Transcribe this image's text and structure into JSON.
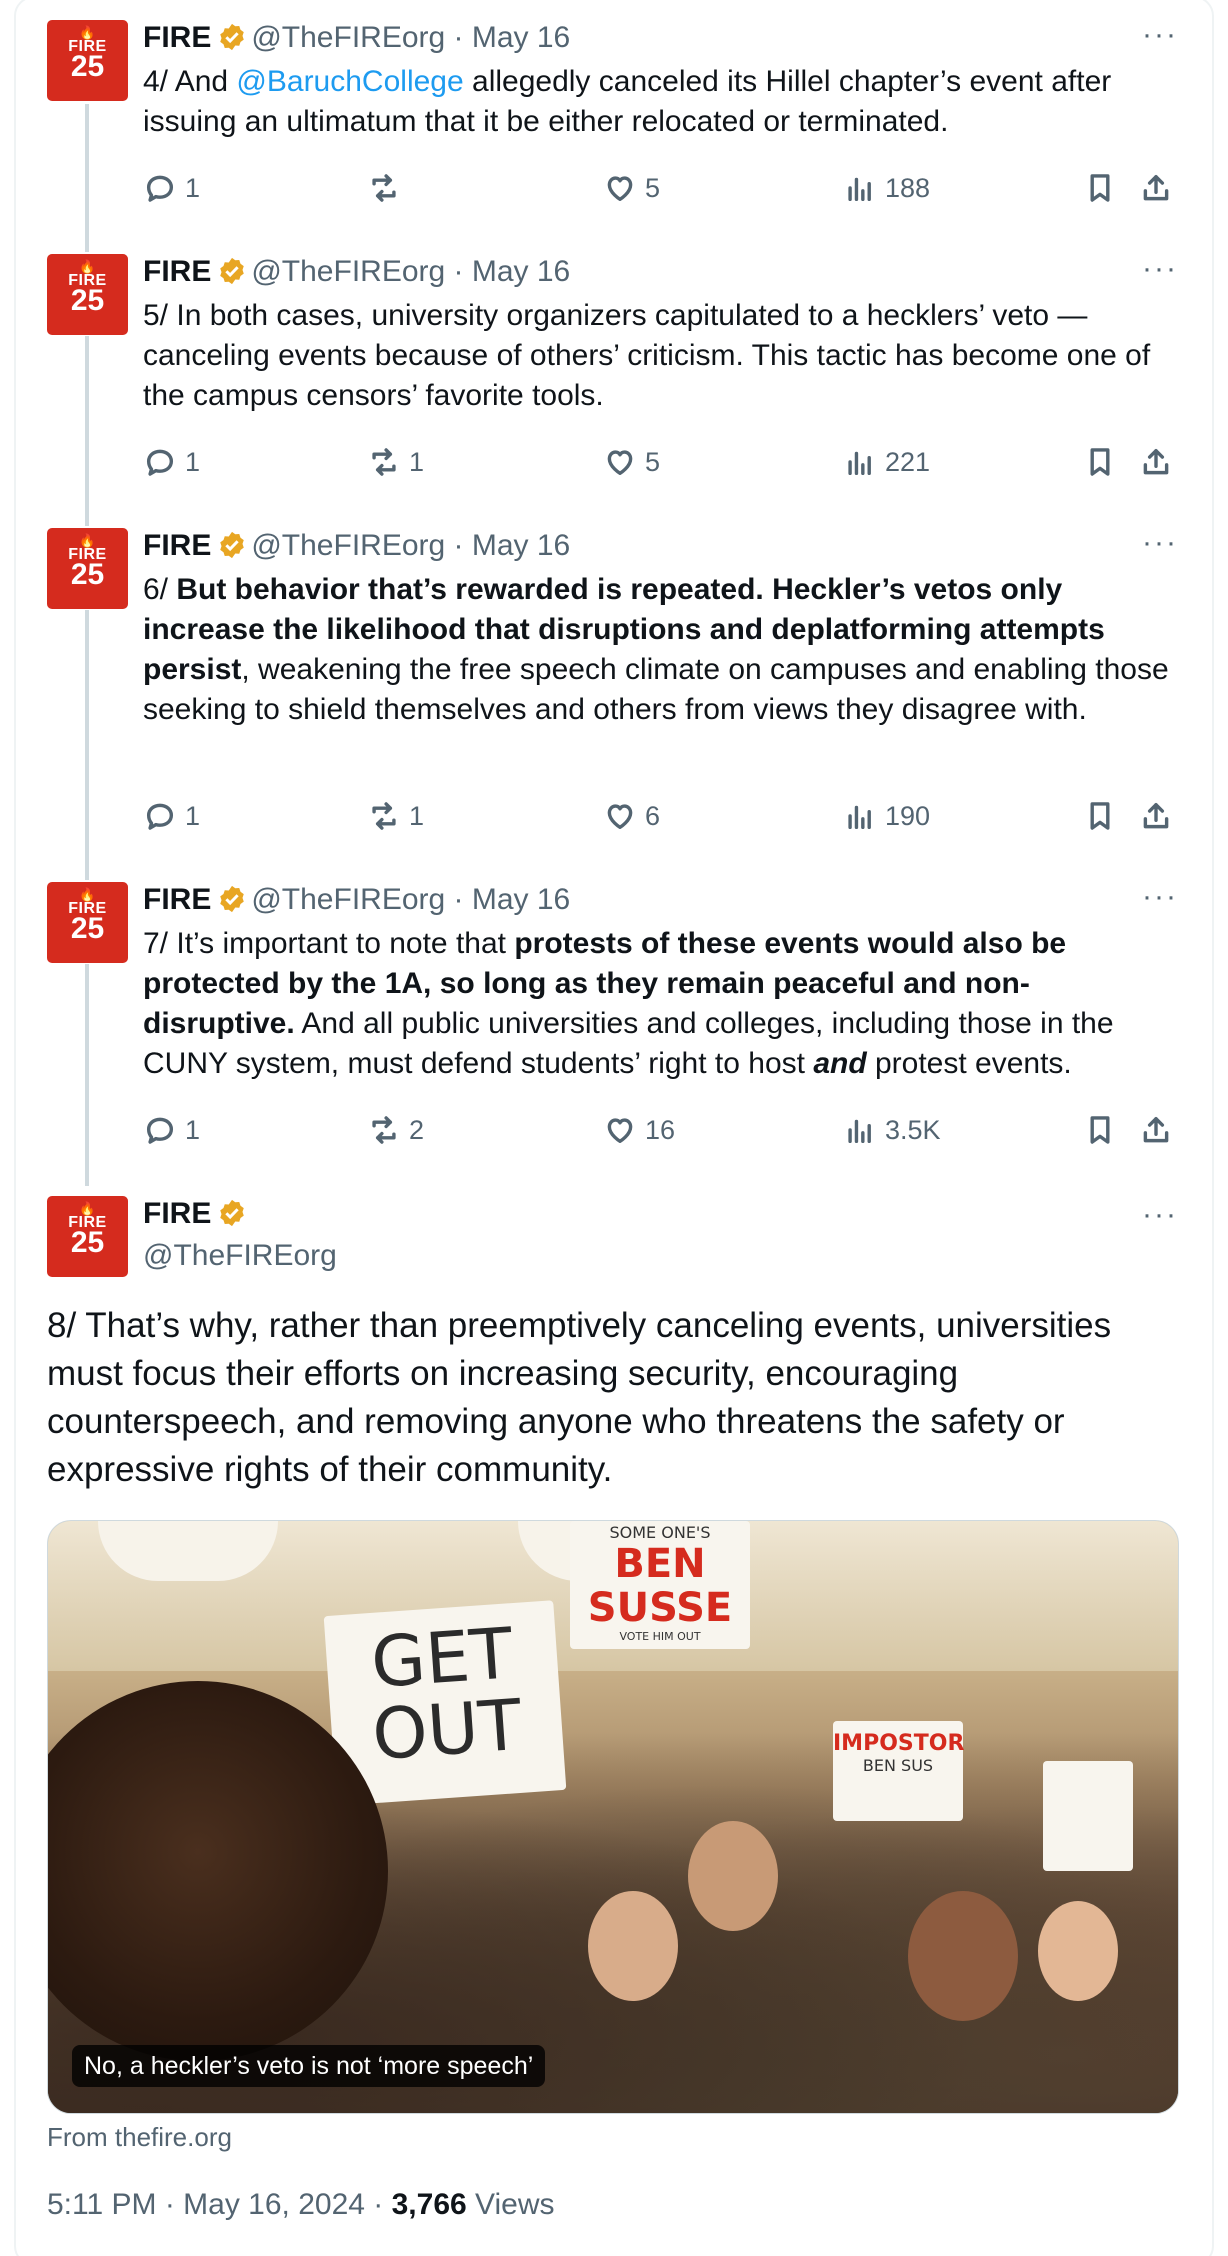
{
  "brand": {
    "accent": "#d52b1e",
    "link": "#1d9bf0",
    "muted": "#536471"
  },
  "avatar": {
    "flame": "🔥",
    "word": "FIRE",
    "num": "25"
  },
  "tweets": [
    {
      "name": "FIRE",
      "handle": "@TheFIREorg",
      "date": "· May 16",
      "segments": [
        {
          "t": "4/ And "
        },
        {
          "t": "@BaruchCollege",
          "link": true
        },
        {
          "t": " allegedly canceled its Hillel chapter’s event after issuing an ultimatum that it be either relocated or terminated."
        }
      ],
      "replies": "1",
      "reposts": "",
      "likes": "5",
      "views": "188"
    },
    {
      "name": "FIRE",
      "handle": "@TheFIREorg",
      "date": "· May 16",
      "segments": [
        {
          "t": "5/ In both cases, university organizers capitulated to a hecklers’ veto — canceling events because of others’ criticism. This tactic has become one of the campus censors’ favorite tools."
        }
      ],
      "replies": "1",
      "reposts": "1",
      "likes": "5",
      "views": "221"
    },
    {
      "name": "FIRE",
      "handle": "@TheFIREorg",
      "date": "· May 16",
      "segments": [
        {
          "t": "6/ "
        },
        {
          "t": "But behavior that’s rewarded is repeated. Heckler’s vetos only increase the likelihood that disruptions and deplatforming attempts persist",
          "bold": true
        },
        {
          "t": ", weakening the free speech climate on campuses and enabling those seeking to shield themselves and others from views they disagree with."
        }
      ],
      "replies": "1",
      "reposts": "1",
      "likes": "6",
      "views": "190"
    },
    {
      "name": "FIRE",
      "handle": "@TheFIREorg",
      "date": "· May 16",
      "segments": [
        {
          "t": "7/ It’s important to note that "
        },
        {
          "t": "protests of these events would also be protected by the 1A, so long as they remain peaceful and non-disruptive.",
          "bold": true
        },
        {
          "t": " And all public universities and colleges, including those in the CUNY system, must defend students’ right to host "
        },
        {
          "t": "and",
          "bold": true,
          "italic": true
        },
        {
          "t": " protest events."
        }
      ],
      "replies": "1",
      "reposts": "2",
      "likes": "16",
      "views": "3.5K"
    }
  ],
  "main": {
    "name": "FIRE",
    "handle": "@TheFIREorg",
    "text": "8/ That’s why, rather than preemptively canceling events, universities must focus their efforts on increasing security, encouraging counterspeech, and removing anyone who threatens the safety or expressive rights of their community.",
    "image": {
      "caption": "No, a heckler’s veto is not ‘more speech’",
      "sign_get_out": "GET OUT",
      "sign_someones": "SOME ONE'S",
      "sign_ben_susse": "BEN SUSSE",
      "sign_vote": "VOTE HIM OUT",
      "sign_impostor": "IMPOSTOR",
      "sign_ben_sus": "BEN SUS"
    },
    "from": "From thefire.org",
    "time": "5:11 PM · May 16, 2024 · ",
    "views_count": "3,766",
    "views_label": " Views"
  },
  "more_label": "···"
}
